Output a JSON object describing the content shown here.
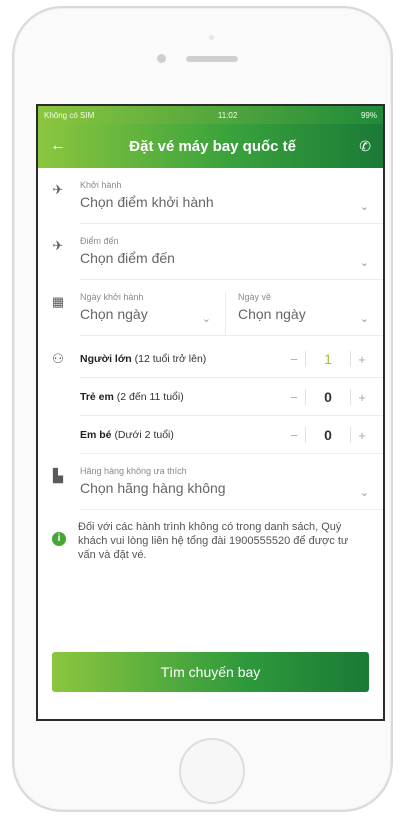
{
  "status_bar": {
    "carrier": "Không có SIM",
    "time": "11:02",
    "battery": "99%"
  },
  "header": {
    "title": "Đặt vé máy bay quốc tế",
    "back_icon": "arrow-left-icon",
    "phone_icon": "phone-icon"
  },
  "departure": {
    "label": "Khởi hành",
    "placeholder": "Chọn điểm khởi hành"
  },
  "destination": {
    "label": "Điểm đến",
    "placeholder": "Chọn điểm đến"
  },
  "dates": {
    "depart_label": "Ngày khởi hành",
    "depart_value": "Chọn ngày",
    "return_label": "Ngày về",
    "return_value": "Chọn ngày"
  },
  "passengers": [
    {
      "name": "Người lớn",
      "desc": "(12 tuổi trở lên)",
      "count": "1"
    },
    {
      "name": "Trẻ em",
      "desc": "(2 đến 11 tuổi)",
      "count": "0"
    },
    {
      "name": "Em bé",
      "desc": "(Dưới 2 tuổi)",
      "count": "0"
    }
  ],
  "airline": {
    "label": "Hãng hàng không ưa thích",
    "placeholder": "Chọn hãng hàng không"
  },
  "note": "Đối với các hành trình không có trong danh sách, Quý khách vui lòng liên hệ tổng đài 1900555520 để được tư vấn và đặt vé.",
  "search_button": "Tìm chuyến bay",
  "colors": {
    "accent_start": "#8cc63f",
    "accent_end": "#1a7a36"
  }
}
